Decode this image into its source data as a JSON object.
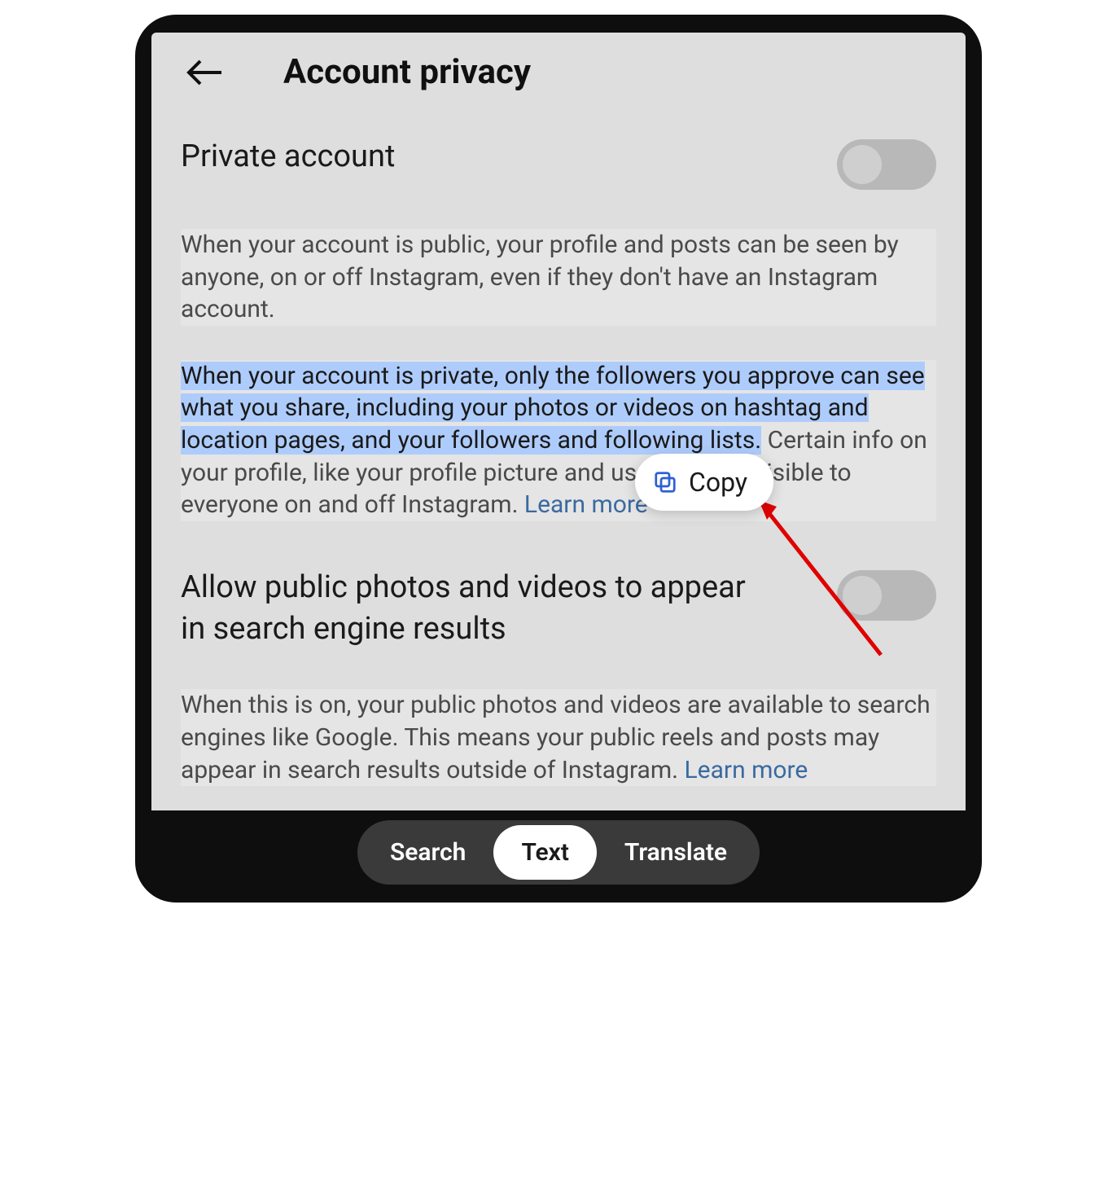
{
  "header": {
    "title": "Account privacy"
  },
  "settings": {
    "private_account": {
      "label": "Private account",
      "desc_public": "When your account is public, your profile and posts can be seen by anyone, on or off Instagram, even if they don't have an Instagram account.",
      "desc_private_highlighted": "When your account is private, only the followers you approve can see what you share, including your photos or videos on hashtag and location pages, and your followers and following lists.",
      "desc_private_rest": " Certain info on your profile, like your profile picture and username, is visible to everyone on and off Instagram. ",
      "learn_more": "Learn more"
    },
    "search_engine": {
      "label": "Allow public photos and videos to appear in search engine results",
      "desc": "When this is on, your public photos and videos are available to search engines like Google. This means your public reels and posts may appear in search results outside of Instagram. ",
      "learn_more": "Learn more"
    }
  },
  "popup": {
    "copy_label": "Copy"
  },
  "bottom_bar": {
    "search": "Search",
    "text": "Text",
    "translate": "Translate"
  }
}
